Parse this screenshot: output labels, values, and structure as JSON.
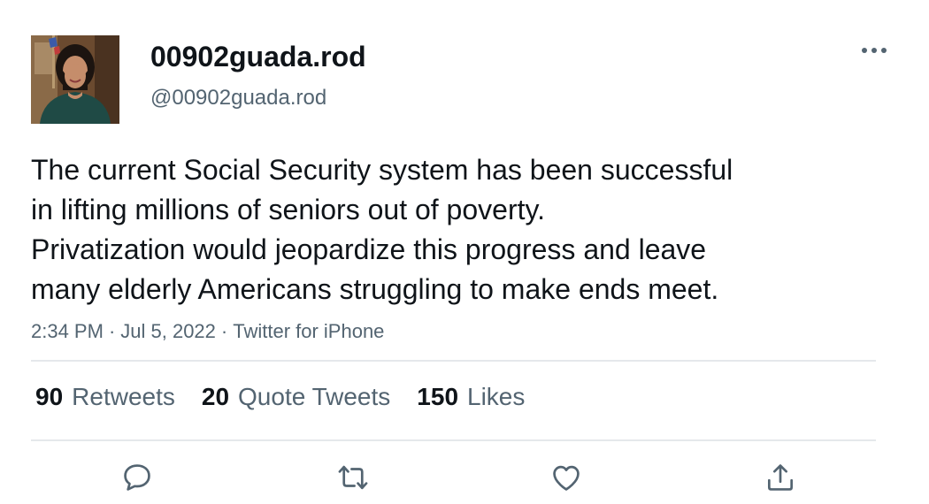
{
  "author": {
    "display_name": "00902guada.rod",
    "handle": "@00902guada.rod",
    "avatar_icon": "profile-photo"
  },
  "tweet": {
    "text_lines": [
      "The current Social Security system has been successful",
      "in lifting millions of seniors out of poverty.",
      "Privatization would jeopardize this progress and leave",
      "many elderly Americans struggling to make ends meet."
    ],
    "time": "2:34 PM",
    "separator": "·",
    "date": "Jul 5, 2022",
    "source": "Twitter for iPhone"
  },
  "stats": {
    "retweets_count": "90",
    "retweets_label": "Retweets",
    "quotes_count": "20",
    "quotes_label": "Quote Tweets",
    "likes_count": "150",
    "likes_label": "Likes"
  },
  "icons": {
    "more": "more-dots-icon",
    "reply": "reply-bubble-icon",
    "retweet": "retweet-arrows-icon",
    "like": "heart-icon",
    "share": "share-upload-icon"
  },
  "colors": {
    "text_primary": "#0f1419",
    "text_secondary": "#536471",
    "divider": "#e5e8eb",
    "icon": "#536471"
  }
}
